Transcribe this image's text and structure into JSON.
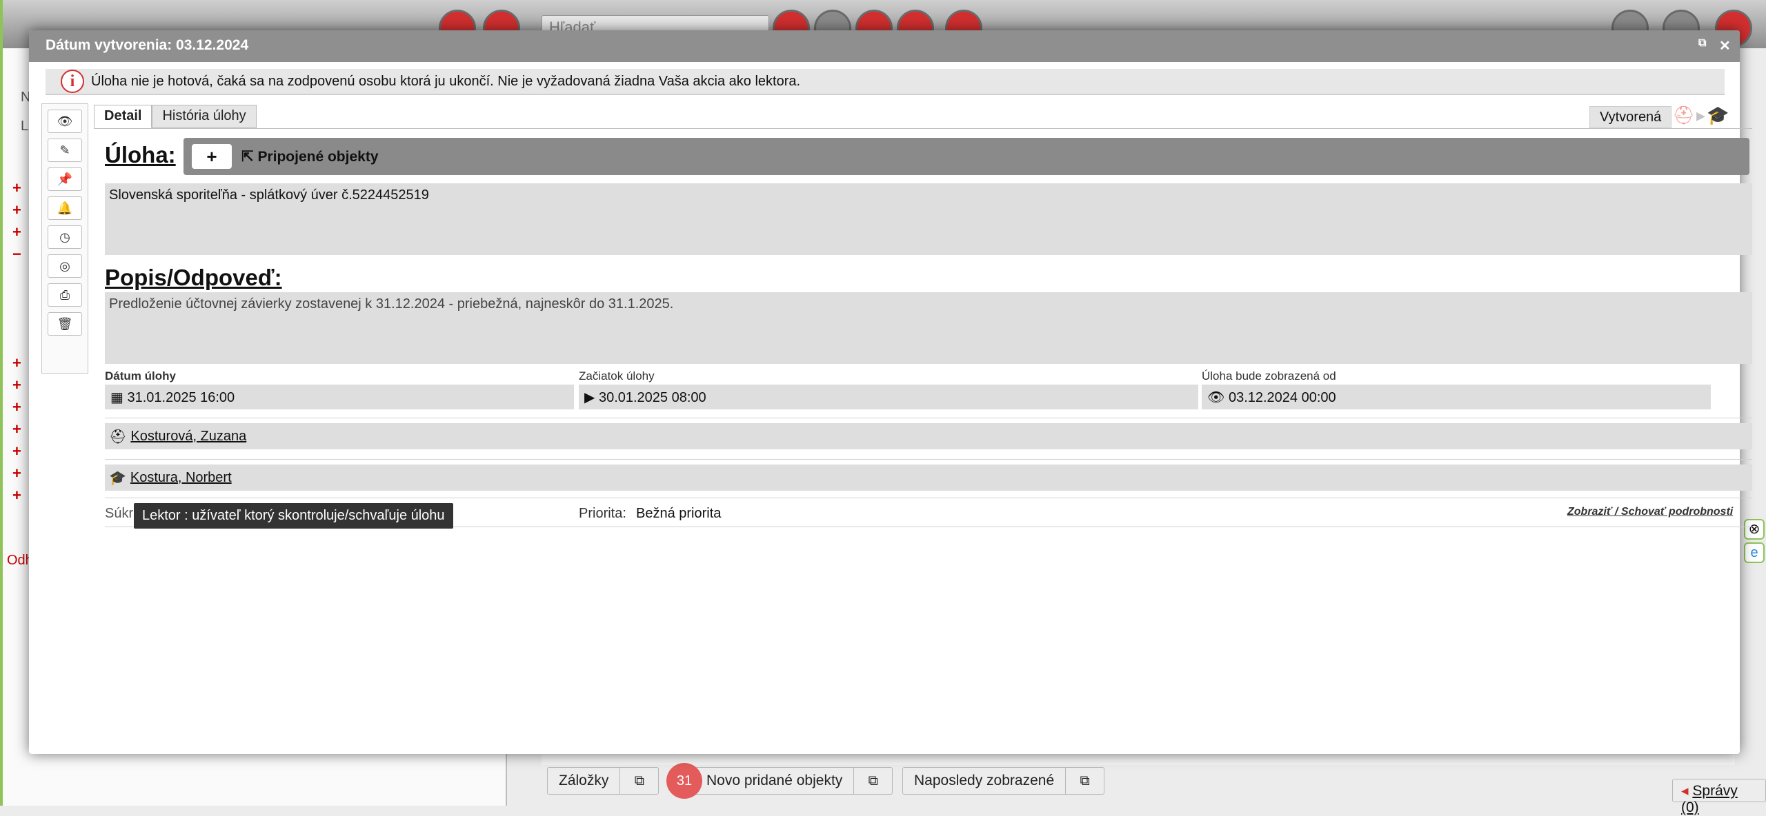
{
  "background": {
    "search_placeholder": "Hľadať",
    "left_letters": [
      "N",
      "L"
    ],
    "left_bottom_label": "Odh",
    "bottom_tabs": {
      "bookmarks": "Záložky",
      "new_objects": "Novo pridané objekty",
      "new_objects_count": "31",
      "recent": "Naposledy zobrazené"
    },
    "messages": "Správy (0)"
  },
  "modal": {
    "title": "Dátum vytvorenia: 03.12.2024",
    "info_message": "Úloha nie je hotová, čaká sa na zodpovenú osobu ktorá ju ukončí. Nie je vyžadovaná žiadna Vaša akcia ako lektora.",
    "tabs": [
      "Detail",
      "História úlohy"
    ],
    "status": "Vytvorená",
    "task_heading": "Úloha:",
    "add_label": "+",
    "attached_objects": "Pripojené objekty",
    "task_text": "Slovenská sporiteľňa - splátkový úver č.5224452519",
    "description_heading": "Popis/Odpoveď:",
    "description_text": "Predloženie účtovnej závierky zostavenej k 31.12.2024 - priebežná, najneskôr do 31.1.2025.",
    "fields": {
      "task_date_label": "Dátum úlohy",
      "task_date_value": "31.01.2025 16:00",
      "start_label": "Začiatok úlohy",
      "start_value": "30.01.2025 08:00",
      "visible_from_label": "Úloha bude zobrazená od",
      "visible_from_value": "03.12.2024 00:00"
    },
    "responsible_person": "Kosturová, Zuzana",
    "lector_person": "Kostura, Norbert",
    "private_label": "Súkr",
    "priority_label": "Priorita:",
    "priority_value": "Bežná priorita",
    "toggle_details": "Zobraziť / Schovať podrobnosti",
    "tooltip": "Lektor : užívateľ ktorý skontroluje/schvaľuje úlohu"
  }
}
